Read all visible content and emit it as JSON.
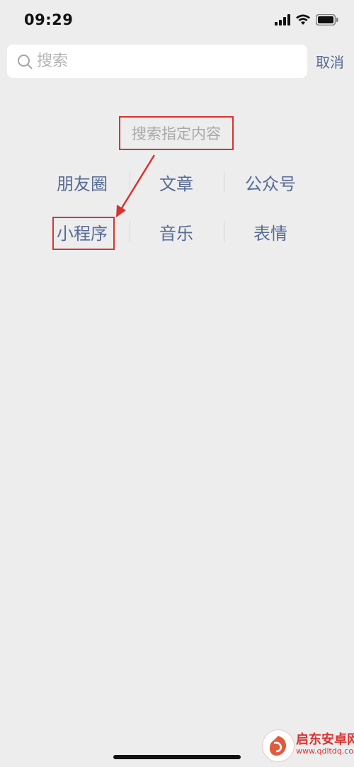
{
  "status_bar": {
    "time": "09:29"
  },
  "search": {
    "placeholder": "搜索",
    "cancel_label": "取消"
  },
  "section": {
    "title": "搜索指定内容"
  },
  "categories": [
    {
      "label": "朋友圈"
    },
    {
      "label": "文章"
    },
    {
      "label": "公众号"
    },
    {
      "label": "小程序"
    },
    {
      "label": "音乐"
    },
    {
      "label": "表情"
    }
  ],
  "watermark": {
    "name": "启东安卓网",
    "url": "www.qdltdq.com"
  },
  "colors": {
    "background": "#ededed",
    "link": "#576b95",
    "annotation_red": "#d9332f",
    "placeholder": "#b2b2b2"
  }
}
